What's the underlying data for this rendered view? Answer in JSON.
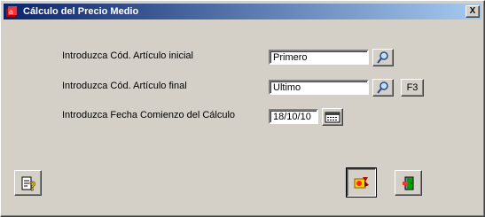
{
  "window": {
    "title": "Cálculo del Precio Medio",
    "close_label": "X"
  },
  "form": {
    "articulo_inicial_label": "Introduzca Cód. Artículo inicial",
    "articulo_inicial_value": "Primero",
    "articulo_final_label": "Introduzca Cód. Artículo final",
    "articulo_final_value": "Ultimo",
    "f3_label": "F3",
    "fecha_label": "Introduzca Fecha Comienzo del Cálculo",
    "fecha_value": "18/10/10"
  },
  "icons": {
    "search": "magnifier-icon",
    "calendar": "calendar-icon",
    "help": "help-icon",
    "execute": "calculate-icon",
    "exit": "exit-door-icon"
  }
}
